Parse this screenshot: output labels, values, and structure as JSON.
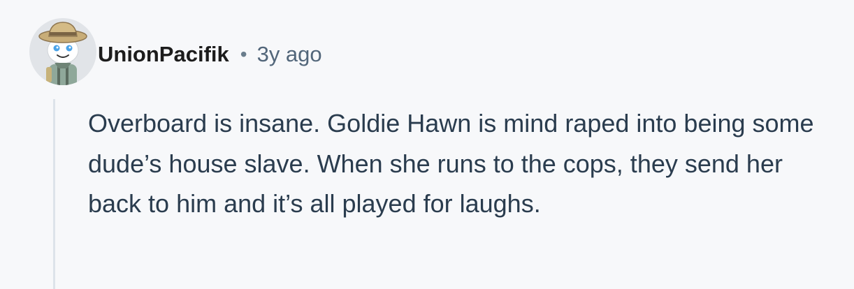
{
  "comment": {
    "author": "UnionPacifik",
    "separator": "•",
    "timestamp": "3y ago",
    "avatar_icon": "snoo-explorer-avatar-icon",
    "body": "Overboard is insane. Goldie Hawn is mind raped into being some dude’s house slave. When she runs to the cops, they send her back to him and it’s all played for laughs."
  }
}
